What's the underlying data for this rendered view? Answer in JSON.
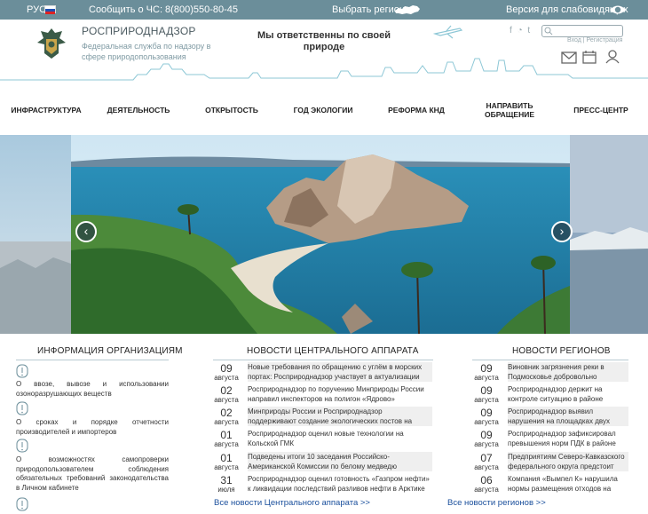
{
  "topbar": {
    "lang": "РУС",
    "phone": "Сообщить о ЧС: 8(800)550-80-45",
    "region": "Выбрать регион",
    "vision": "Версия для слабовидящих"
  },
  "header": {
    "org_name": "РОСПРИРОДНАДЗОР",
    "org_desc": "Федеральная служба по надзору в сфере природопользования",
    "slogan": "Мы ответственны по своей природе",
    "login": "Вход | Регистрация"
  },
  "nav": {
    "items": [
      {
        "label": "ИНФРАСТРУКТУРА"
      },
      {
        "label": "ДЕЯТЕЛЬНОСТЬ"
      },
      {
        "label": "ОТКРЫТОСТЬ"
      },
      {
        "label": "ГОД ЭКОЛОГИИ"
      },
      {
        "label": "РЕФОРМА КНД"
      },
      {
        "label": "НАПРАВИТЬ ОБРАЩЕНИЕ"
      },
      {
        "label": "ПРЕСС-ЦЕНТР"
      }
    ]
  },
  "slider": {
    "prev": "‹",
    "next": "›"
  },
  "info": {
    "title": "ИНФОРМАЦИЯ ОРГАНИЗАЦИЯМ",
    "items": [
      "О ввозе, вывозе и использовании озоноразрушающих веществ",
      "О сроках и порядке отчетности производителей и импортеров",
      "О возможностях самопроверки природопользователем соблюдения обязательных требований законодательства в Личном кабинете"
    ]
  },
  "central_news": {
    "title": "НОВОСТИ ЦЕНТРАЛЬНОГО АППАРАТА",
    "items": [
      {
        "day": "09",
        "month": "августа",
        "text": "Новые требования по обращению с углём в морских портах: Росприроднадзор участвует в актуализации"
      },
      {
        "day": "02",
        "month": "августа",
        "text": "Росприроднадзор по поручению Минприроды России направил инспекторов на полигон «Ядрово»"
      },
      {
        "day": "02",
        "month": "августа",
        "text": "Минприроды России и Росприроднадзор поддерживают создание экологических постов на"
      },
      {
        "day": "01",
        "month": "августа",
        "text": "Росприроднадзор оценил новые технологии на Кольской ГМК"
      },
      {
        "day": "01",
        "month": "августа",
        "text": "Подведены итоги 10 заседания Российско-Американской Комиссии по белому медведю"
      },
      {
        "day": "31",
        "month": "июля",
        "text": "Росприроднадзор оценил готовность «Газпром нефти» к ликвидации последствий разливов нефти в Арктике"
      }
    ],
    "all_link": "Все новости Центрального аппарата >>"
  },
  "region_news": {
    "title": "НОВОСТИ РЕГИОНОВ",
    "items": [
      {
        "day": "09",
        "month": "августа",
        "text": "Виновник загрязнения реки в Подмосковье добровольно"
      },
      {
        "day": "09",
        "month": "августа",
        "text": "Росприроднадзор держит на контроле ситуацию в районе"
      },
      {
        "day": "09",
        "month": "августа",
        "text": "Росприроднадзор выявил нарушения на площадках двух"
      },
      {
        "day": "09",
        "month": "августа",
        "text": "Росприроднадзор зафиксировал превышения норм ПДК в районе"
      },
      {
        "day": "07",
        "month": "августа",
        "text": "Предприятиям Северо-Кавказского федерального округа предстоит"
      },
      {
        "day": "06",
        "month": "августа",
        "text": "Компания «Вымпел К» нарушила нормы размещения отходов на"
      }
    ],
    "all_link": "Все новости регионов >>"
  },
  "colors": {
    "topbar": "#6b8e9a",
    "link": "#1a4f9c",
    "accent": "#8dc7d6"
  }
}
